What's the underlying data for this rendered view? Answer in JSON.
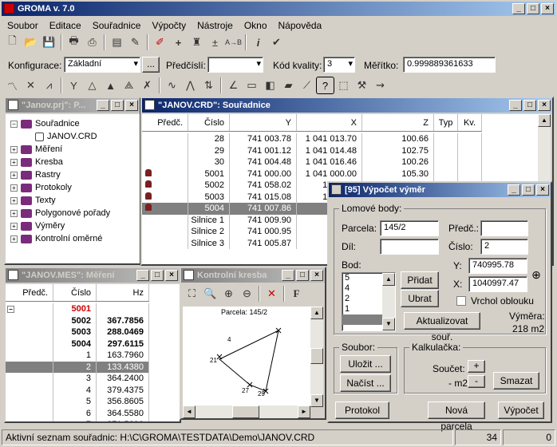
{
  "app": {
    "title": "GROMA v. 7.0"
  },
  "menu": [
    "Soubor",
    "Editace",
    "Souřadnice",
    "Výpočty",
    "Nástroje",
    "Okno",
    "Nápověda"
  ],
  "config": {
    "konfigurace_label": "Konfigurace:",
    "konfigurace_value": "Základní",
    "browse": "...",
    "predcisli_label": "Předčíslí:",
    "predcisli_value": "",
    "kod_label": "Kód kvality:",
    "kod_value": "3",
    "meritko_label": "Měřítko:",
    "meritko_value": "0.999889361633"
  },
  "project": {
    "title": "\"Janov.prj\": P...",
    "tree": [
      {
        "label": "Souřadnice",
        "expand": "−",
        "level": 0
      },
      {
        "label": "JANOV.CRD",
        "expand": "",
        "level": 1
      },
      {
        "label": "Měření",
        "expand": "+",
        "level": 0
      },
      {
        "label": "Kresba",
        "expand": "+",
        "level": 0
      },
      {
        "label": "Rastry",
        "expand": "+",
        "level": 0
      },
      {
        "label": "Protokoly",
        "expand": "+",
        "level": 0
      },
      {
        "label": "Texty",
        "expand": "+",
        "level": 0
      },
      {
        "label": "Polygonové pořady",
        "expand": "+",
        "level": 0
      },
      {
        "label": "Výměry",
        "expand": "+",
        "level": 0
      },
      {
        "label": "Kontrolní oměrné",
        "expand": "+",
        "level": 0
      }
    ]
  },
  "coords": {
    "title": "\"JANOV.CRD\": Souřadnice",
    "headers": [
      "Předč.",
      "Číslo",
      "Y",
      "X",
      "Z",
      "Typ",
      "Kv."
    ],
    "rows": [
      {
        "lock": false,
        "cislo": "28",
        "y": "741 003.78",
        "x": "1 041 013.70",
        "z": "100.66",
        "sel": false
      },
      {
        "lock": false,
        "cislo": "29",
        "y": "741 001.12",
        "x": "1 041 014.48",
        "z": "102.75",
        "sel": false
      },
      {
        "lock": false,
        "cislo": "30",
        "y": "741 004.48",
        "x": "1 041 016.46",
        "z": "100.26",
        "sel": false
      },
      {
        "lock": true,
        "cislo": "5001",
        "y": "741 000.00",
        "x": "1 041 000.00",
        "z": "105.30",
        "sel": false
      },
      {
        "lock": true,
        "cislo": "5002",
        "y": "741 058.02",
        "x": "1 041 00",
        "z": "",
        "sel": false
      },
      {
        "lock": true,
        "cislo": "5003",
        "y": "741 015.08",
        "x": "1 041 06",
        "z": "",
        "sel": false
      },
      {
        "lock": true,
        "cislo": "5004",
        "y": "741 007.86",
        "x": "1 04",
        "z": "",
        "sel": true
      },
      {
        "lock": false,
        "cislo": "Silnice 1",
        "y": "741 009.90",
        "x": "1 04",
        "z": "",
        "sel": false
      },
      {
        "lock": false,
        "cislo": "Silnice 2",
        "y": "741 000.95",
        "x": "1 04",
        "z": "",
        "sel": false
      },
      {
        "lock": false,
        "cislo": "Silnice 3",
        "y": "741 005.87",
        "x": "1 04",
        "z": "",
        "sel": false
      }
    ]
  },
  "mereni": {
    "title": "\"JANOV.MES\": Měření",
    "headers": [
      "Předč.",
      "Číslo",
      "Hz"
    ],
    "rows": [
      {
        "cislo": "5001",
        "hz": "",
        "bold": true,
        "red": true,
        "sel": false,
        "exp": "−"
      },
      {
        "cislo": "5002",
        "hz": "367.7856",
        "bold": true,
        "red": false,
        "sel": false,
        "exp": ""
      },
      {
        "cislo": "5003",
        "hz": "288.0469",
        "bold": true,
        "red": false,
        "sel": false,
        "exp": ""
      },
      {
        "cislo": "5004",
        "hz": "297.6115",
        "bold": true,
        "red": false,
        "sel": false,
        "exp": ""
      },
      {
        "cislo": "1",
        "hz": "163.7960",
        "bold": false,
        "red": false,
        "sel": false,
        "exp": ""
      },
      {
        "cislo": "2",
        "hz": "133.4380",
        "bold": false,
        "red": false,
        "sel": true,
        "exp": ""
      },
      {
        "cislo": "3",
        "hz": "364.2400",
        "bold": false,
        "red": false,
        "sel": false,
        "exp": ""
      },
      {
        "cislo": "4",
        "hz": "379.4375",
        "bold": false,
        "red": false,
        "sel": false,
        "exp": ""
      },
      {
        "cislo": "5",
        "hz": "356.8605",
        "bold": false,
        "red": false,
        "sel": false,
        "exp": ""
      },
      {
        "cislo": "6",
        "hz": "364.5580",
        "bold": false,
        "red": false,
        "sel": false,
        "exp": ""
      },
      {
        "cislo": "7",
        "hz": "371.5290",
        "bold": false,
        "red": false,
        "sel": false,
        "exp": ""
      }
    ]
  },
  "kresba": {
    "title": "Kontrolní kresba",
    "parcela": "Parcela: 145/2",
    "points": [
      "4",
      "21",
      "27",
      "29"
    ]
  },
  "vymer": {
    "title": "[95] Výpočet výměr",
    "lomove": "Lomové body:",
    "parcela_label": "Parcela:",
    "parcela_value": "145/2",
    "dil_label": "Díl:",
    "dil_value": "",
    "predc_label": "Předč.:",
    "predc_value": "",
    "cislo_label": "Číslo:",
    "cislo_value": "2",
    "bod_label": "Bod:",
    "bod_list": [
      "5",
      "4",
      "2",
      "1",
      ""
    ],
    "pridat": "Přidat",
    "ubrat": "Ubrat",
    "y_label": "Y:",
    "y_value": "740995.78",
    "x_label": "X:",
    "x_value": "1040997.47",
    "vrchol": "Vrchol oblouku",
    "aktualizovat": "Aktualizovat souř.",
    "vymera_label": "Výměra:",
    "vymera_value": "218 m2",
    "soubor": "Soubor:",
    "ulozit": "Uložit ...",
    "nacist": "Načíst ...",
    "kalkulacka": "Kalkulačka:",
    "soucet": "Součet:",
    "plus": "+",
    "minus": "-",
    "m2": "- m2",
    "smazat": "Smazat",
    "protokol": "Protokol",
    "nova": "Nová parcela",
    "vypocet": "Výpočet"
  },
  "status": {
    "text": "Aktivní seznam souřadnic: H:\\C\\GROMA\\TESTDATA\\Demo\\JANOV.CRD",
    "count": "34",
    "num": "0"
  }
}
